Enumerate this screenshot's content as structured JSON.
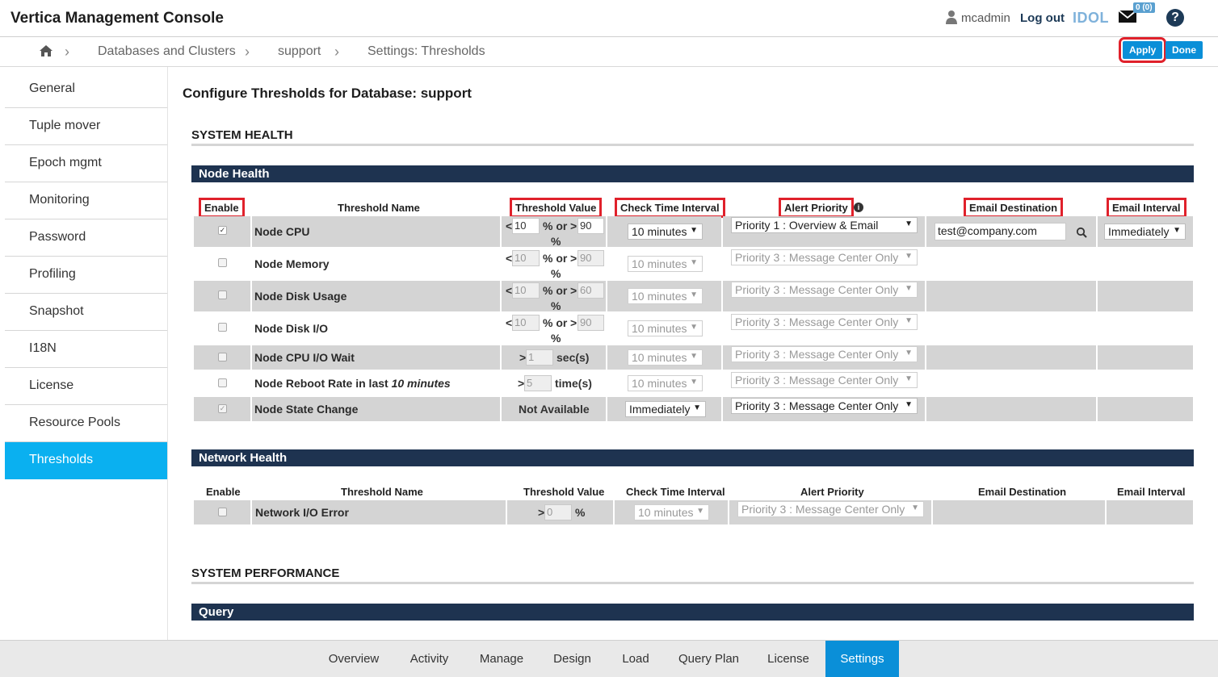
{
  "app": {
    "title": "Vertica Management Console"
  },
  "header": {
    "username": "mcadmin",
    "logout": "Log out",
    "idol": "IDOL",
    "mail_badge": "0 (0)",
    "help": "?"
  },
  "breadcrumb": {
    "items": [
      "Databases and Clusters",
      "support",
      "Settings: Thresholds"
    ],
    "apply_label": "Apply",
    "done_label": "Done"
  },
  "sidebar": {
    "items": [
      "General",
      "Tuple mover",
      "Epoch mgmt",
      "Monitoring",
      "Password",
      "Profiling",
      "Snapshot",
      "I18N",
      "License",
      "Resource Pools",
      "Thresholds"
    ],
    "active": "Thresholds"
  },
  "main": {
    "heading": "Configure Thresholds for Database: support",
    "system_health": "SYSTEM HEALTH",
    "system_performance": "SYSTEM PERFORMANCE",
    "node_health": {
      "title": "Node Health",
      "headers": {
        "enable": "Enable",
        "name": "Threshold Name",
        "value": "Threshold Value",
        "interval": "Check Time Interval",
        "priority": "Alert Priority",
        "email": "Email Destination",
        "email_interval": "Email Interval"
      },
      "rows": [
        {
          "name": "Node CPU",
          "low": "10",
          "high": "90",
          "interval": "10 minutes",
          "priority": "Priority 1 : Overview & Email",
          "email": "test@company.com",
          "email_interval": "Immediately",
          "checked": "✓"
        },
        {
          "name": "Node Memory",
          "low": "10",
          "high": "90",
          "interval": "10 minutes",
          "priority": "Priority 3 : Message Center Only"
        },
        {
          "name": "Node Disk Usage",
          "low": "10",
          "high": "60",
          "interval": "10 minutes",
          "priority": "Priority 3 : Message Center Only"
        },
        {
          "name": "Node Disk I/O",
          "low": "10",
          "high": "90",
          "interval": "10 minutes",
          "priority": "Priority 3 : Message Center Only"
        },
        {
          "name": "Node CPU I/O Wait",
          "single": "1",
          "unit": "sec(s)",
          "interval": "10 minutes",
          "priority": "Priority 3 : Message Center Only"
        },
        {
          "name_prefix": "Node Reboot Rate in last ",
          "name_em": "10 minutes",
          "single": "5",
          "unit": "time(s)",
          "interval": "10 minutes",
          "priority": "Priority 3 : Message Center Only"
        },
        {
          "name": "Node State Change",
          "na": "Not Available",
          "interval": "Immediately",
          "priority": "Priority 3 : Message Center Only",
          "checked": "✓"
        }
      ],
      "pct_or": "% or",
      "pct": "%",
      "lt": "<",
      "gt": ">"
    },
    "network_health": {
      "title": "Network Health",
      "headers": {
        "enable": "Enable",
        "name": "Threshold Name",
        "value": "Threshold Value",
        "interval": "Check Time Interval",
        "priority": "Alert Priority",
        "email": "Email Destination",
        "email_interval": "Email Interval"
      },
      "rows": [
        {
          "name": "Network I/O Error",
          "single": "0",
          "unit": "%",
          "interval": "10 minutes",
          "priority": "Priority 3 : Message Center Only"
        }
      ]
    },
    "query": {
      "title": "Query"
    }
  },
  "bottom_tabs": {
    "items": [
      "Overview",
      "Activity",
      "Manage",
      "Design",
      "Load",
      "Query Plan",
      "License",
      "Settings"
    ],
    "active": "Settings"
  },
  "colors": {
    "accent": "#0ab0f0",
    "band": "#1e3350",
    "highlight": "#e0212b"
  }
}
